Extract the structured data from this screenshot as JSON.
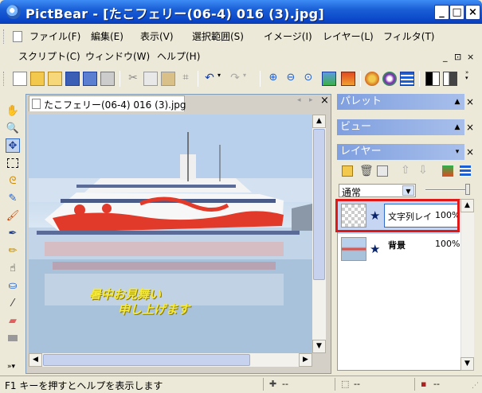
{
  "window": {
    "title": "PictBear - [たこフェリー(06-4) 016 (3).jpg]",
    "minimize_label": "_",
    "maximize_label": "□",
    "close_label": "×"
  },
  "menus": {
    "row1": [
      "ファイル(F)",
      "編集(E)",
      "表示(V)",
      "選択範囲(S)",
      "イメージ(I)",
      "レイヤー(L)",
      "フィルタ(T)"
    ],
    "row2": [
      "スクリプト(C)",
      "ウィンドウ(W)",
      "ヘルプ(H)"
    ],
    "mdi_controls": [
      "_",
      "⊡",
      "×"
    ]
  },
  "document": {
    "tab_title": "たこフェリー(06-4) 016 (3).jpg",
    "tab_nav": [
      "◂",
      "▸",
      "×"
    ],
    "overlay_text_line1": "暑中お見舞い",
    "overlay_text_line2": "申し上げます"
  },
  "panels": {
    "palette_title": "パレット",
    "view_title": "ビュー",
    "layer_title": "レイヤー",
    "blend_mode": "通常",
    "layers": [
      {
        "name": "文字列レイ",
        "opacity": "100%",
        "selected": true
      },
      {
        "name": "背景",
        "opacity": "100%",
        "selected": false
      }
    ]
  },
  "status": {
    "help_text": "F1 キーを押すとヘルプを表示します",
    "coord1": "--",
    "coord2": "--",
    "coord3": "--"
  },
  "colors": {
    "titlebar": "#0a46c8",
    "selection_highlight": "#e01818",
    "panel_header": "#7f9fdf",
    "overlay_text": "#f5e93a"
  }
}
